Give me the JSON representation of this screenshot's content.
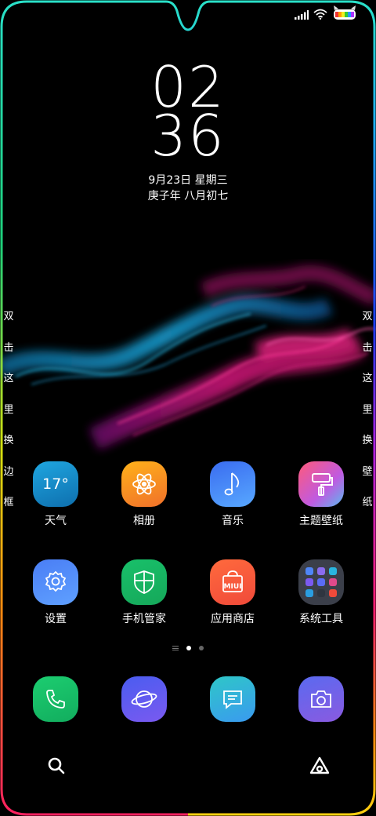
{
  "status_bar": {
    "icons": [
      "signal-icon",
      "wifi-icon",
      "battery-icon"
    ]
  },
  "clock": {
    "hour": "02",
    "minute": "36",
    "date": "9月23日 星期三",
    "lunar": "庚子年 八月初七"
  },
  "side_text": {
    "left": [
      "双",
      "击",
      "这",
      "里",
      "换",
      "边",
      "框"
    ],
    "right": [
      "双",
      "击",
      "这",
      "里",
      "换",
      "壁",
      "纸"
    ]
  },
  "apps_row1": [
    {
      "label": "天气",
      "icon": "weather-icon",
      "icon_text": "17°",
      "color": "#1a8fd0"
    },
    {
      "label": "相册",
      "icon": "gallery-icon",
      "color": "#f7a51c"
    },
    {
      "label": "音乐",
      "icon": "music-icon",
      "color": "#4a8af4"
    },
    {
      "label": "主题壁纸",
      "icon": "themes-icon",
      "color": "#f05a8c"
    }
  ],
  "apps_row2": [
    {
      "label": "设置",
      "icon": "settings-icon",
      "color": "#4f86f7"
    },
    {
      "label": "手机管家",
      "icon": "security-icon",
      "color": "#1fbf6f"
    },
    {
      "label": "应用商店",
      "icon": "app-store-icon",
      "icon_text": "MIUI",
      "color": "#f5613d"
    },
    {
      "label": "系统工具",
      "icon": "folder-icon",
      "color": "#3a3f4a"
    }
  ],
  "dock": [
    {
      "icon": "phone-icon",
      "color": "#19c26b"
    },
    {
      "icon": "browser-icon",
      "color": "#5b63f0"
    },
    {
      "icon": "messages-icon",
      "color": "#34b7d9"
    },
    {
      "icon": "camera-icon",
      "color": "#6a6ef0"
    }
  ],
  "bottom_bar": {
    "left_icon": "search-icon",
    "right_icon": "assistant-icon"
  },
  "page_indicator": {
    "pages": 2,
    "active": 1
  }
}
